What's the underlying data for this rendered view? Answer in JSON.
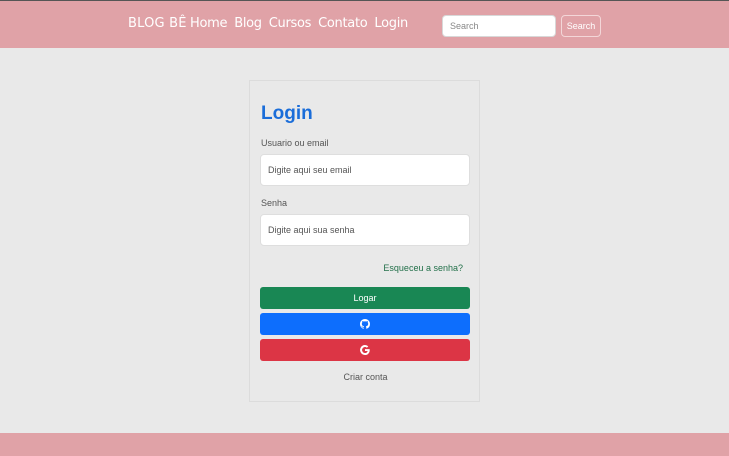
{
  "header": {
    "brand": "BLOG BÊ",
    "nav": [
      "Home",
      "Blog",
      "Cursos",
      "Contato",
      "Login"
    ],
    "search_placeholder": "Search",
    "search_button": "Search"
  },
  "login": {
    "title": "Login",
    "user_label": "Usuario ou email",
    "user_placeholder": "Digite aqui seu email",
    "password_label": "Senha",
    "password_placeholder": "Digite aqui sua senha",
    "forgot": "Esqueceu a senha?",
    "login_button": "Logar",
    "create_account": "Criar conta"
  },
  "colors": {
    "navbar": "#e0a2a7",
    "title": "#1a6dd9",
    "login_button": "#198754",
    "github_button": "#0d6efd",
    "google_button": "#dc3545"
  },
  "icons": {
    "github": "github-icon",
    "google": "google-icon"
  }
}
